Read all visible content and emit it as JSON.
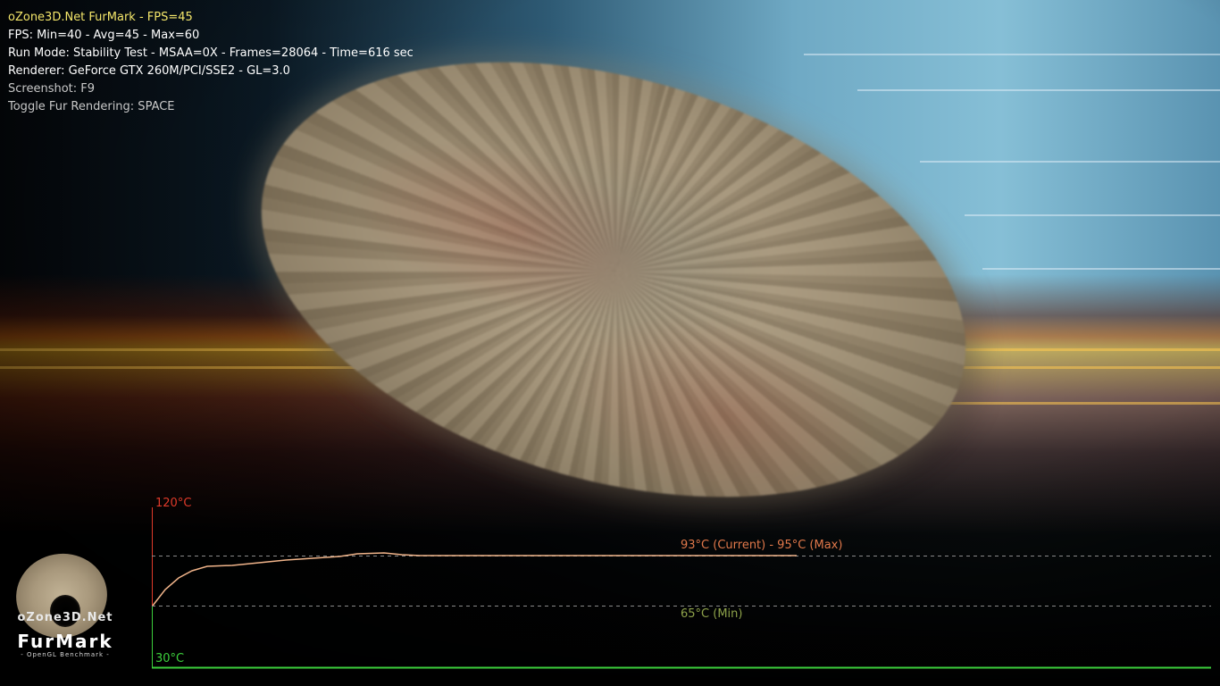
{
  "hud": {
    "title": "oZone3D.Net FurMark - FPS=45",
    "fps_stats": "FPS: Min=40 - Avg=45 - Max=60",
    "run_mode": "Run Mode: Stability Test - MSAA=0X - Frames=28064 - Time=616 sec",
    "renderer": "Renderer: GeForce GTX 260M/PCI/SSE2 - GL=3.0",
    "screenshot_hint": "Screenshot: F9",
    "toggle_hint": "Toggle Fur Rendering: SPACE"
  },
  "temperature_graph": {
    "max_axis_label": "120°C",
    "min_axis_label": "30°C",
    "current_label": "93°C (Current) - 95°C (Max)",
    "min_label": "65°C (Min)",
    "y_range": [
      30,
      120
    ],
    "current_temp": 93,
    "max_temp": 95,
    "min_temp": 65,
    "colors": {
      "max_axis": "#e03a2a",
      "min_axis": "#3ccf3c",
      "curve": "#f0b48a",
      "current_text": "#e0784a",
      "min_text": "#8ea24a",
      "dashed": "#8a8a8a"
    }
  },
  "logo": {
    "site": "oZone3D.Net",
    "name": "FurMark",
    "tagline": "- OpenGL Benchmark -"
  }
}
